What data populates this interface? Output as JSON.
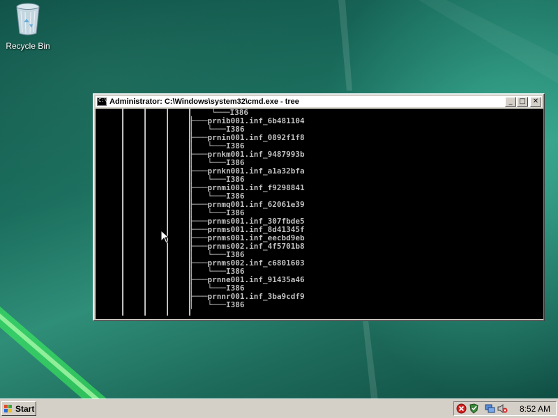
{
  "desktop": {
    "recycle_bin_label": "Recycle Bin"
  },
  "window": {
    "title": "Administrator: C:\\Windows\\system32\\cmd.exe - tree",
    "icon_text": "C:\\",
    "minimize_glyph": "_",
    "maximize_glyph": "□",
    "close_glyph": "✕",
    "console_lines": [
      "└───I386",
      "├───prnib001.inf_6b481104",
      "│   └───I386",
      "├───prnin001.inf_0892f1f8",
      "│   └───I386",
      "├───prnkm001.inf_9487993b",
      "│   └───I386",
      "├───prnkn001.inf_a1a32bfa",
      "│   └───I386",
      "├───prnmi001.inf_f9298841",
      "│   └───I386",
      "├───prnmq001.inf_62061e39",
      "│   └───I386",
      "├───prnms001.inf_307fbde5",
      "├───prnms001.inf_8d41345f",
      "├───prnms001.inf_eecbd9eb",
      "├───prnms002.inf_4f5701b8",
      "│   └───I386",
      "├───prnms002.inf_c6801603",
      "│   └───I386",
      "├───prnne001.inf_91435a46",
      "│   └───I386",
      "├───prnnr001.inf_3ba9cdf9",
      "│   └───I386"
    ]
  },
  "taskbar": {
    "start_label": "Start",
    "clock": "8:52 AM"
  },
  "colors": {
    "console_bg": "#000000",
    "console_text": "#c0c0c0",
    "taskbar_bg": "#d4d0c8"
  }
}
